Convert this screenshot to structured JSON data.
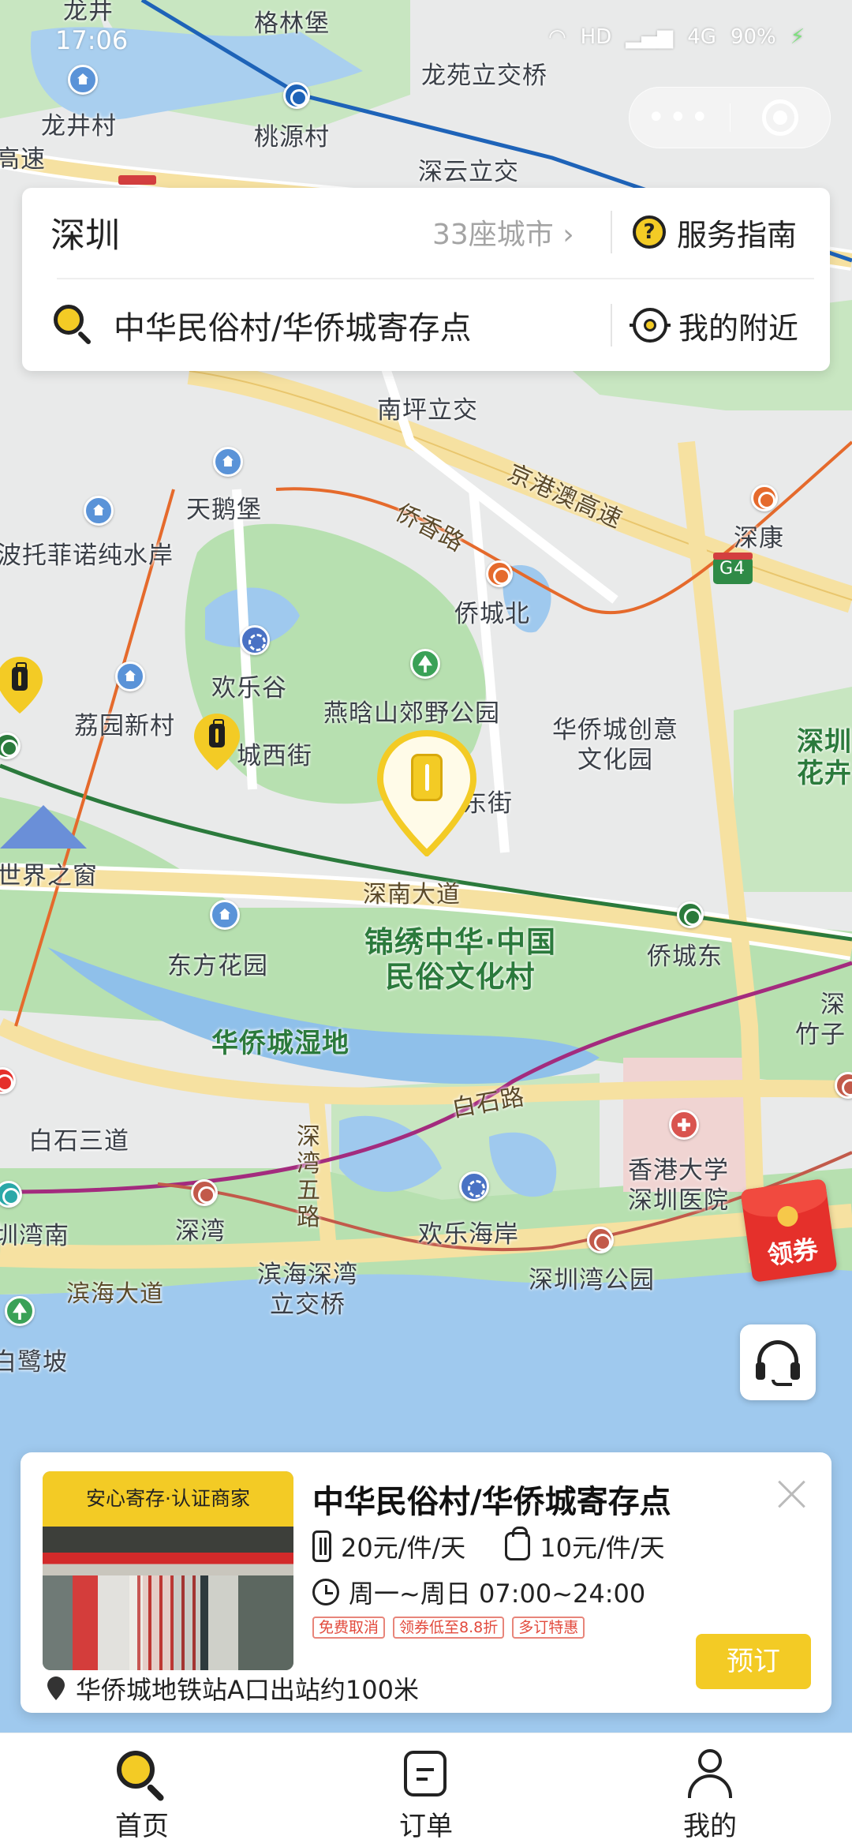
{
  "status_bar": {
    "time": "17:06",
    "network": "HD",
    "signal": "4G",
    "battery": "90%"
  },
  "capsule": {
    "menu_label": "•••"
  },
  "search": {
    "city": "深圳",
    "city_count": "33座城市",
    "guide_label": "服务指南",
    "query": "中华民俗村/华侨城寄存点",
    "nearby_label": "我的附近"
  },
  "map": {
    "labels": {
      "longjing": "龙井",
      "gelinbao": "格林堡",
      "longyuan_bridge": "龙苑立交桥",
      "longjingcun": "龙井村",
      "taoyuancun": "桃源村",
      "gaosu": "高速",
      "shenyun_bridge": "深云立交",
      "nanping_bridge": "南坪立交",
      "jinggangao": "京港澳高速",
      "tianebao": "天鹅堡",
      "qiaoxiang_road": "侨香路",
      "shenkang": "深康",
      "potuofeinuo": "波托菲诺纯水岸",
      "qiaochengbei": "侨城北",
      "g4": "G4",
      "huanlegu": "欢乐谷",
      "yanhanshan": "燕晗山郊野公园",
      "liyuanxincun": "荔园新村",
      "chengxijie": "城西街",
      "hqc_creative": "华侨城创意\n文化园",
      "shenzhen_right": "深圳\n花卉",
      "dongjie": "东街",
      "window_world": "世界之窗",
      "shennan_road": "深南大道",
      "dongfanghuayuan": "东方花园",
      "jinxiu": "锦绣中华·中国\n民俗文化村",
      "qiaochengdong": "侨城东",
      "zhuzi": "深\n竹子",
      "hqc_wetland": "华侨城湿地",
      "baishi_road": "白石路",
      "baishi_3": "白石三道",
      "shenwan_5": "深\n湾\n五\n路",
      "hku_hospital": "香港大学\n深圳医院",
      "wanan": "圳湾南",
      "shenwan": "深湾",
      "huanlehaian": "欢乐海岸",
      "binhai_ave": "滨海大道",
      "binhai_bridge": "滨海深湾\n立交桥",
      "sz_bay_park": "深圳湾公园",
      "bailupo": "白鹭坡"
    }
  },
  "coupon": {
    "label": "领券"
  },
  "store": {
    "badge": "安心寄存·认证商家",
    "name": "中华民俗村/华侨城寄存点",
    "price_luggage": "20元/件/天",
    "price_bag": "10元/件/天",
    "hours": "周一~周日 07:00~24:00",
    "tags": [
      "免费取消",
      "领券低至8.8折",
      "多订特惠"
    ],
    "address": "华侨城地铁站A口出站约100米",
    "book_label": "预订"
  },
  "tabbar": {
    "home": "首页",
    "orders": "订单",
    "me": "我的"
  },
  "colors": {
    "accent": "#f3cb25",
    "water": "#9fc9ee",
    "park": "#b7e0b0",
    "road": "#f6e1a1"
  }
}
